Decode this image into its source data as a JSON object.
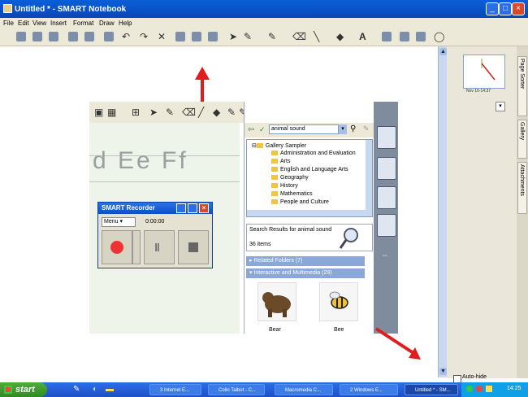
{
  "window": {
    "title": "Untitled * - SMART Notebook"
  },
  "menu": [
    "File",
    "Edit",
    "View",
    "Insert",
    "Format",
    "Draw",
    "Help"
  ],
  "toolbar": {
    "text_tool": "A"
  },
  "handwriting": {
    "text": "d Ee Ff"
  },
  "recorder": {
    "title": "SMART Recorder",
    "dropdown": "Menu",
    "time": "0:00:00"
  },
  "gallery": {
    "search_value": "animal sound",
    "root": "Gallery Sampler",
    "folders": [
      "Administration and Evaluation",
      "Arts",
      "English and Language Arts",
      "Geography",
      "History",
      "Mathematics",
      "People and Culture"
    ],
    "results_title": "Search Results for animal sound",
    "items_count": "36 items",
    "related": "Related Folders (7)",
    "interactive": "Interactive and Multimedia (29)",
    "thumbs": [
      "Bear",
      "Bee"
    ]
  },
  "page_sorter": {
    "thumb_label": "Nov 16-14:37",
    "autohide": "Auto-hide"
  },
  "sidetabs": [
    "Page Sorter",
    "Gallery",
    "Attachments"
  ],
  "taskbar": {
    "start": "start",
    "tasks": [
      "3 Internet E...",
      "Colin Talbot - C...",
      "Macromedia C...",
      "2 Windows E...",
      "Untitled * - SM..."
    ],
    "clock": "14:25"
  },
  "colors": {
    "arrow": "#e01c1c",
    "titlebar": "#0a5fd8",
    "start": "#3a9a2e"
  }
}
